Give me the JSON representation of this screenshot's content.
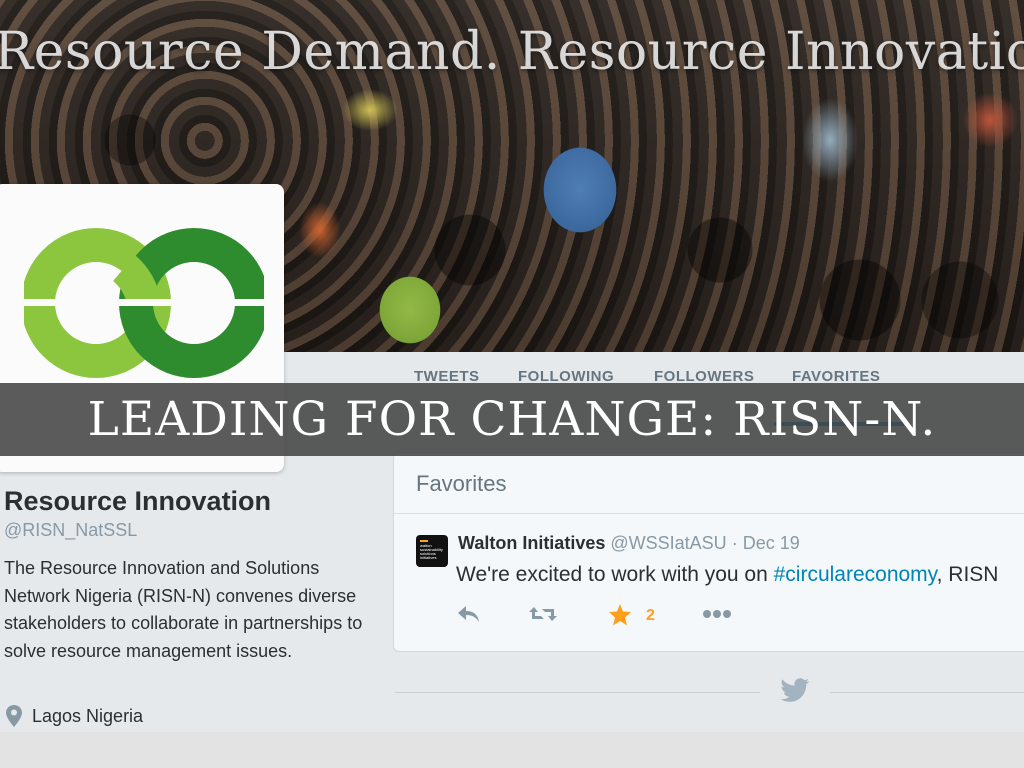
{
  "banner": {
    "title": "Resource Demand. Resource Innovatio"
  },
  "profile": {
    "name": "Resource Innovation",
    "handle": "@RISN_NatSSL",
    "bio": "The Resource Innovation and Solutions Network Nigeria (RISN-N) convenes diverse stakeholders to collaborate in partnerships to solve resource management issues.",
    "location": "Lagos Nigeria",
    "location_icon": "map-pin-icon",
    "logo_colors": {
      "light": "#8cc63f",
      "dark": "#2e8b2e"
    }
  },
  "stats": [
    {
      "label": "TWEETS",
      "value": ""
    },
    {
      "label": "FOLLOWING",
      "value": ""
    },
    {
      "label": "FOLLOWERS",
      "value": ""
    },
    {
      "label": "FAVORITES",
      "value": ""
    }
  ],
  "favorites": {
    "title": "Favorites",
    "tweet": {
      "author": "Walton Initiatives",
      "handle": "@WSSIatASU",
      "date": "Dec 19",
      "text_before": "We're excited to work with you on ",
      "hashtag": "#circulareconomy",
      "text_after": ", RISN",
      "favorite_count": "2",
      "avatar_text": "walton sustainability solutions initiatives",
      "actions": [
        "reply-icon",
        "retweet-icon",
        "favorite-star-icon",
        "more-icon"
      ]
    }
  },
  "footer": {
    "icon": "twitter-bird-icon"
  },
  "overlay": {
    "text": "LEADING FOR CHANGE: RISN-N."
  },
  "colors": {
    "link": "#0084b4",
    "favorite": "#ff9f1c",
    "overlay_bg": "#444444"
  }
}
